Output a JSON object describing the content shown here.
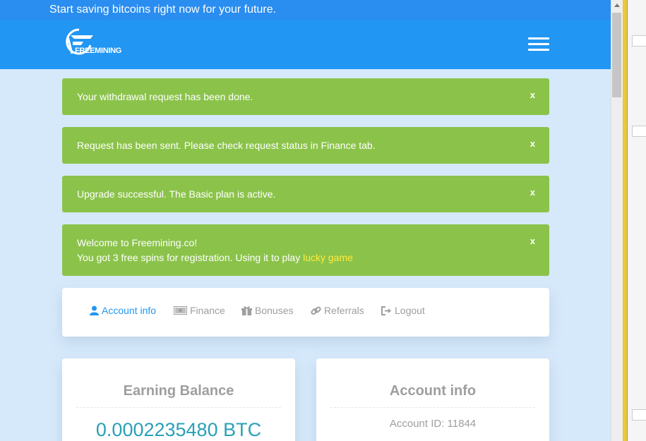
{
  "promo": {
    "text": "Start saving bitcoins right now for your future."
  },
  "brand": {
    "logo_text": "FREEMINING"
  },
  "alerts": [
    {
      "message": "Your withdrawal request has been done.",
      "close": "x"
    },
    {
      "message": "Request has been sent. Please check request status in Finance tab.",
      "close": "x"
    },
    {
      "message": "Upgrade successful. The Basic plan is active.",
      "close": "x"
    },
    {
      "line1": "Welcome to Freemining.co!",
      "line2": "You got 3 free spins for registration. Using it to play ",
      "link": "lucky game",
      "close": "x"
    }
  ],
  "tabs": [
    {
      "label": "Account info",
      "icon": "user-icon",
      "active": true
    },
    {
      "label": "Finance",
      "icon": "money-icon",
      "active": false
    },
    {
      "label": "Bonuses",
      "icon": "gift-icon",
      "active": false
    },
    {
      "label": "Referrals",
      "icon": "link-icon",
      "active": false
    },
    {
      "label": "Logout",
      "icon": "sign-out-icon",
      "active": false
    }
  ],
  "earning": {
    "title": "Earning Balance",
    "value": "0.0002235480 BTC"
  },
  "account": {
    "title": "Account info",
    "id_line": "Account ID: 11844"
  },
  "colors": {
    "navbar": "#2196f3",
    "alert": "#8bc34a",
    "link": "#ffeb3b",
    "page_bg": "#d6e9fb",
    "active_tab": "#2196f3"
  }
}
